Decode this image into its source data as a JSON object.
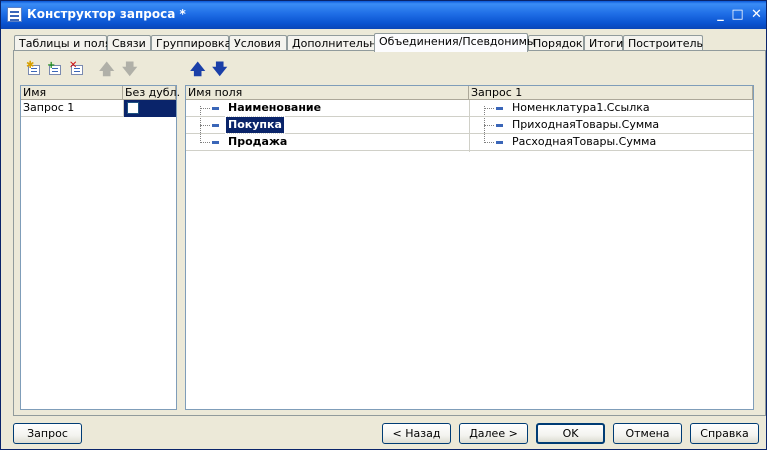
{
  "window": {
    "title": "Конструктор запроса *"
  },
  "tabs": [
    "Таблицы и поля",
    "Связи",
    "Группировка",
    "Условия",
    "Дополнительно",
    "Объединения/Псевдонимы",
    "Порядок",
    "Итоги",
    "Построитель"
  ],
  "active_tab": "Объединения/Псевдонимы",
  "toolbar": {
    "icons": [
      "add-query-icon",
      "copy-query-icon",
      "delete-query-icon",
      "move-up-icon",
      "move-down-icon"
    ],
    "field_arrows": [
      "field-up-icon",
      "field-down-icon"
    ]
  },
  "queries_table": {
    "headers": [
      "Имя",
      "Без дубл."
    ],
    "rows": [
      {
        "name": "Запрос 1",
        "no_duplicates": false
      }
    ]
  },
  "fields_table": {
    "headers": [
      "Имя поля",
      "Запрос 1"
    ],
    "rows": [
      {
        "field": "Наименование",
        "source": "Номенклатура1.Ссылка"
      },
      {
        "field": "Покупка",
        "source": "ПриходнаяТовары.Сумма"
      },
      {
        "field": "Продажа",
        "source": "РасходнаяТовары.Сумма"
      }
    ],
    "selected_field": "Покупка"
  },
  "buttons": {
    "query": "Запрос",
    "back": "< Назад",
    "next": "Далее >",
    "ok": "OK",
    "cancel": "Отмена",
    "help": "Справка"
  },
  "colors": {
    "title_bar": "#0a53d0",
    "selection": "#0a246a",
    "arrow_blue": "#1a3fa8"
  }
}
